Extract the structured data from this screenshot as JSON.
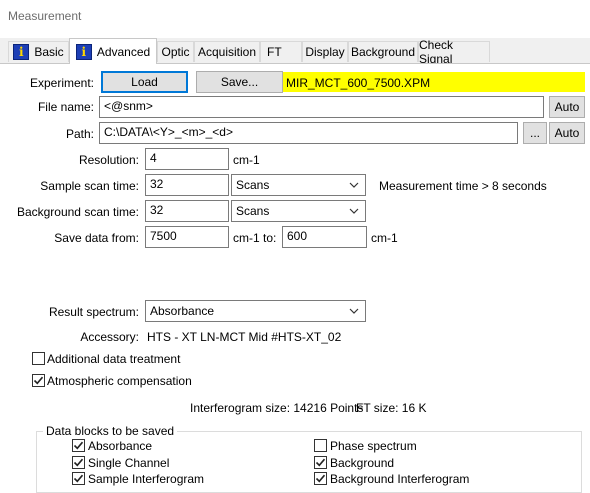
{
  "window": {
    "title": "Measurement"
  },
  "tabs": [
    {
      "label": "Basic"
    },
    {
      "label": "Advanced"
    },
    {
      "label": "Optic"
    },
    {
      "label": "Acquisition"
    },
    {
      "label": "FT"
    },
    {
      "label": "Display"
    },
    {
      "label": "Background"
    },
    {
      "label": "Check Signal"
    }
  ],
  "experiment": {
    "label": "Experiment:",
    "load_label": "Load",
    "save_label": "Save...",
    "filename": "MIR_MCT_600_7500.XPM",
    "highlight": "#ffff00"
  },
  "file_name": {
    "label": "File name:",
    "value": "<@snm>",
    "auto_label": "Auto"
  },
  "path": {
    "label": "Path:",
    "value": "C:\\DATA\\<Y>_<m>_<d>",
    "browse_label": "...",
    "auto_label": "Auto"
  },
  "resolution": {
    "label": "Resolution:",
    "value": "4",
    "unit": "cm-1"
  },
  "sample_scan": {
    "label": "Sample scan time:",
    "value": "32",
    "unit": "Scans",
    "info": "Measurement time > 8 seconds"
  },
  "background_scan": {
    "label": "Background scan time:",
    "value": "32",
    "unit": "Scans"
  },
  "save_data": {
    "label": "Save data from:",
    "from": "7500",
    "from_unit": "cm-1 to:",
    "to": "600",
    "to_unit": "cm-1"
  },
  "result_spectrum": {
    "label": "Result spectrum:",
    "value": "Absorbance"
  },
  "accessory": {
    "label": "Accessory:",
    "value": "HTS - XT LN-MCT Mid #HTS-XT_02"
  },
  "options": [
    {
      "label": "Additional data treatment",
      "checked": false
    },
    {
      "label": "Atmospheric compensation",
      "checked": true
    }
  ],
  "sizes": {
    "interferogram": "Interferogram size: 14216 Points",
    "ft": "FT size: 16 K"
  },
  "data_blocks": {
    "title": "Data blocks to be saved",
    "left": [
      {
        "label": "Absorbance",
        "checked": true
      },
      {
        "label": "Single Channel",
        "checked": true
      },
      {
        "label": "Sample Interferogram",
        "checked": true
      }
    ],
    "right": [
      {
        "label": "Phase spectrum",
        "checked": false
      },
      {
        "label": "Background",
        "checked": true
      },
      {
        "label": "Background Interferogram",
        "checked": true
      }
    ]
  }
}
